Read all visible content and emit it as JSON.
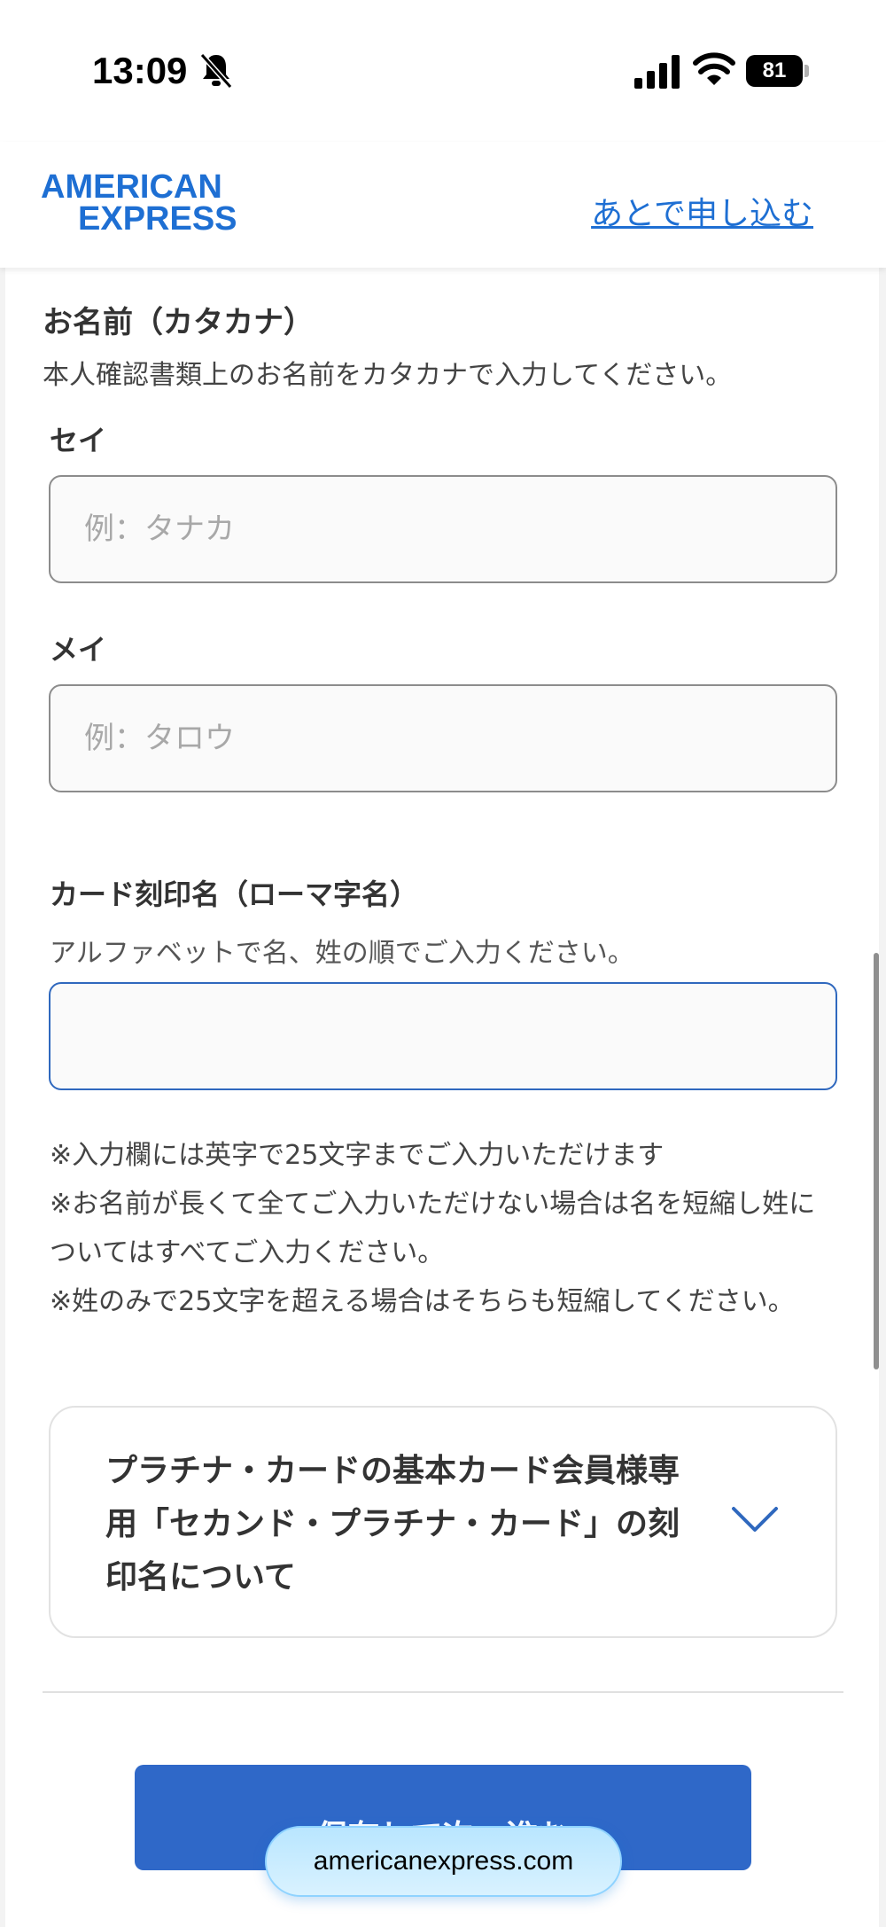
{
  "status_bar": {
    "time": "13:09",
    "battery": "81"
  },
  "header": {
    "logo_line1": "AMERICAN",
    "logo_line2": "EXPRESS",
    "apply_later": "あとで申し込む"
  },
  "kana_section": {
    "title": "お名前（カタカナ）",
    "description": "本人確認書類上のお名前をカタカナで入力してください。",
    "last_name": {
      "label": "セイ",
      "placeholder": "例：タナカ",
      "value": ""
    },
    "first_name": {
      "label": "メイ",
      "placeholder": "例：タロウ",
      "value": ""
    }
  },
  "card_name": {
    "label": "カード刻印名（ローマ字名）",
    "description": "アルファベットで名、姓の順でご入力ください。",
    "value": "",
    "notes": [
      "※入力欄には英字で25文字までご入力いただけます",
      "※お名前が長くて全てご入力いただけない場合は名を短縮し姓についてはすべてご入力ください。",
      "※姓のみで25文字を超える場合はそちらも短縮してください。"
    ]
  },
  "accordion": {
    "title": "プラチナ・カードの基本カード会員様専用「セカンド・プラチナ・カード」の刻印名について",
    "icon": "chevron-down-icon"
  },
  "actions": {
    "next_button": "保存して次へ進む"
  },
  "browser": {
    "url": "americanexpress.com"
  },
  "colors": {
    "brand": "#1e6fd3",
    "primary_button": "#2f68c8",
    "active_border": "#2f68be"
  }
}
